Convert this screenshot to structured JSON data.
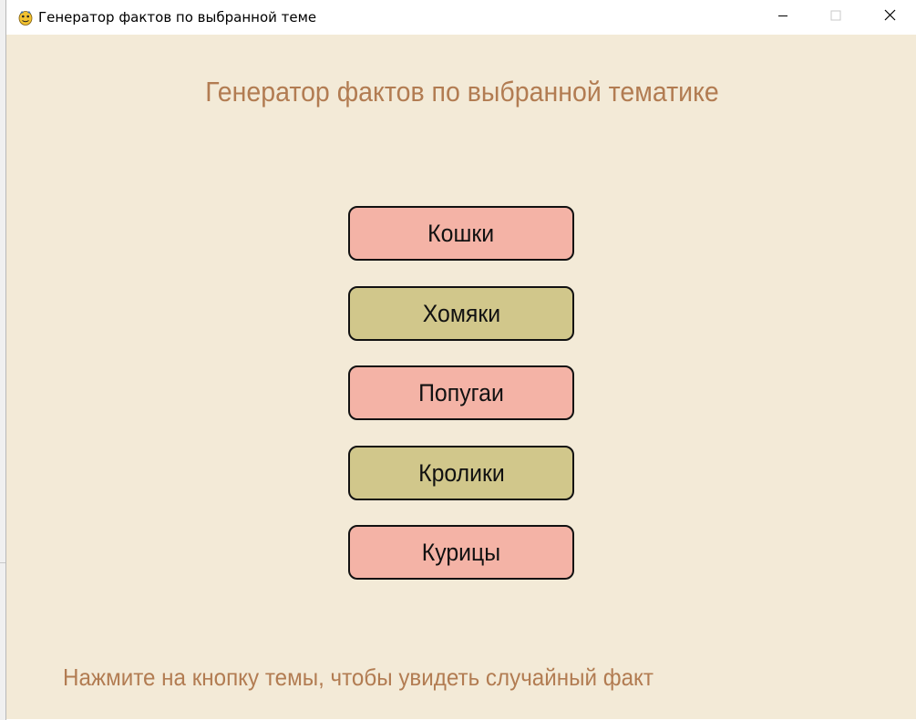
{
  "window": {
    "title": "Генератор фактов по выбранной теме",
    "icon": "python-icon"
  },
  "controls": {
    "minimize": "minimize-icon",
    "maximize": "maximize-icon",
    "close": "close-icon"
  },
  "main": {
    "heading": "Генератор фактов по выбранной тематике",
    "topics": [
      {
        "label": "Кошки",
        "color": "#f4b3a6"
      },
      {
        "label": "Хомяки",
        "color": "#d1c78b"
      },
      {
        "label": "Попугаи",
        "color": "#f4b3a6"
      },
      {
        "label": "Кролики",
        "color": "#d1c78b"
      },
      {
        "label": "Курицы",
        "color": "#f4b3a6"
      }
    ],
    "hint": "Нажмите на кнопку темы, чтобы увидеть случайный факт"
  },
  "colors": {
    "background": "#f3ead7",
    "text_accent": "#b27c52",
    "button_border": "#111111"
  }
}
